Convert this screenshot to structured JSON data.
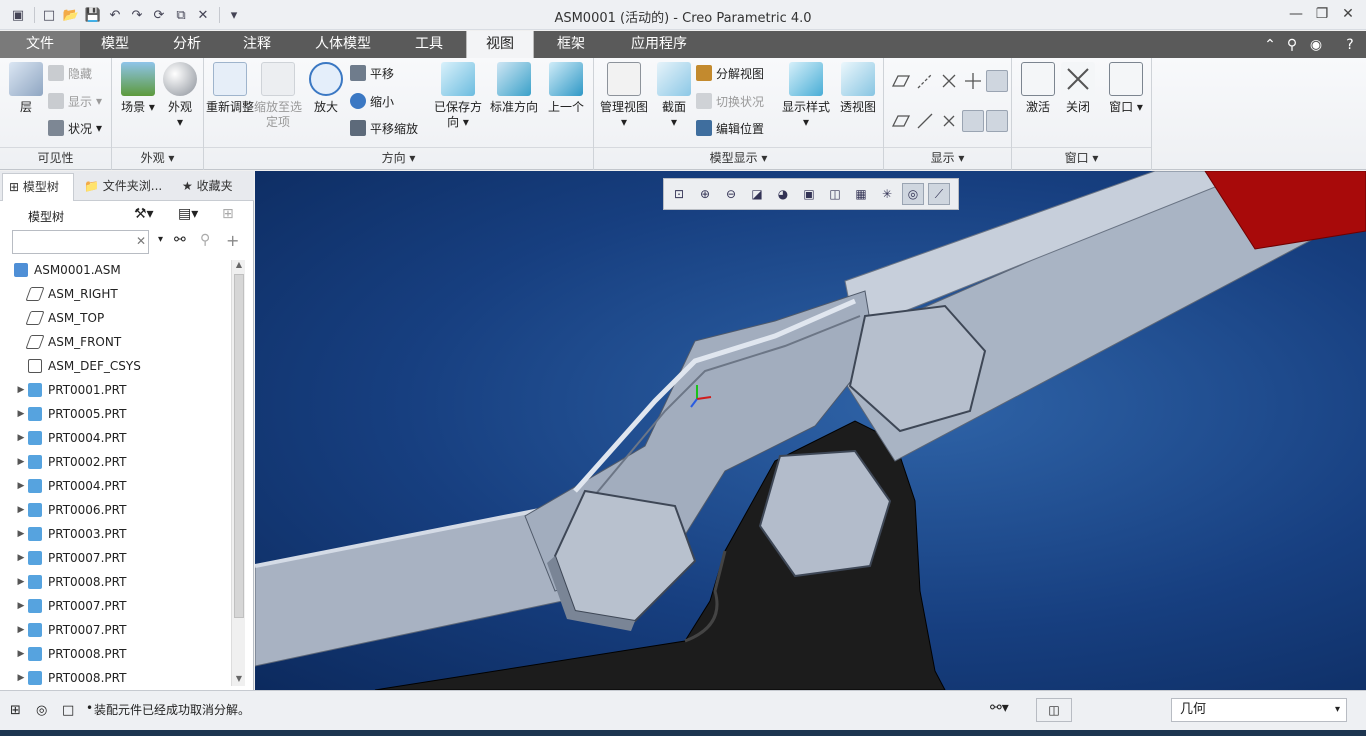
{
  "window": {
    "title": "ASM0001 (活动的) - Creo Parametric 4.0"
  },
  "quick_access": [
    "new-icon",
    "open-icon",
    "save-icon",
    "undo-icon",
    "redo-icon",
    "regenerate-icon",
    "windows-icon",
    "close-window-icon",
    "customize-icon"
  ],
  "tabs": [
    {
      "label": "文件"
    },
    {
      "label": "模型"
    },
    {
      "label": "分析"
    },
    {
      "label": "注释"
    },
    {
      "label": "人体模型"
    },
    {
      "label": "工具"
    },
    {
      "label": "视图"
    },
    {
      "label": "框架"
    },
    {
      "label": "应用程序"
    }
  ],
  "ribbon": {
    "visibility": {
      "label": "可见性",
      "layer": "层",
      "hide": "隐藏",
      "show": "显示",
      "status": "状况"
    },
    "appearance": {
      "label": "外观",
      "scene": "场景",
      "appearance": "外观"
    },
    "orientation": {
      "label": "方向",
      "refit": "重新调整",
      "zoom_selected": "缩放至选定项",
      "zoom_in": "放大",
      "pan": "平移",
      "zoom_out": "缩小",
      "pan_zoom": "平移缩放",
      "saved_orientations": "已保存方向",
      "standard_orientation": "标准方向",
      "previous": "上一个"
    },
    "model_display": {
      "label": "模型显示",
      "manage_views": "管理视图",
      "section": "截面",
      "explode_view": "分解视图",
      "toggle_status": "切换状况",
      "edit_position": "编辑位置",
      "display_style": "显示样式",
      "perspective": "透视图"
    },
    "show": {
      "label": "显示"
    },
    "window": {
      "label": "窗口",
      "activate": "激活",
      "close": "关闭",
      "window": "窗口"
    }
  },
  "panel": {
    "tabs": [
      "模型树",
      "文件夹浏...",
      "收藏夹"
    ],
    "tree_header": "模型树",
    "search_placeholder": "",
    "tree": [
      {
        "name": "ASM0001.ASM",
        "kind": "asm",
        "expandable": false
      },
      {
        "name": "ASM_RIGHT",
        "kind": "plane",
        "expandable": false
      },
      {
        "name": "ASM_TOP",
        "kind": "plane",
        "expandable": false
      },
      {
        "name": "ASM_FRONT",
        "kind": "plane",
        "expandable": false
      },
      {
        "name": "ASM_DEF_CSYS",
        "kind": "csys",
        "expandable": false
      },
      {
        "name": "PRT0001.PRT",
        "kind": "part",
        "expandable": true
      },
      {
        "name": "PRT0005.PRT",
        "kind": "part",
        "expandable": true
      },
      {
        "name": "PRT0004.PRT",
        "kind": "part",
        "expandable": true
      },
      {
        "name": "PRT0002.PRT",
        "kind": "part",
        "expandable": true
      },
      {
        "name": "PRT0004.PRT",
        "kind": "part",
        "expandable": true
      },
      {
        "name": "PRT0006.PRT",
        "kind": "part",
        "expandable": true
      },
      {
        "name": "PRT0003.PRT",
        "kind": "part",
        "expandable": true
      },
      {
        "name": "PRT0007.PRT",
        "kind": "part",
        "expandable": true
      },
      {
        "name": "PRT0008.PRT",
        "kind": "part",
        "expandable": true
      },
      {
        "name": "PRT0007.PRT",
        "kind": "part",
        "expandable": true
      },
      {
        "name": "PRT0007.PRT",
        "kind": "part",
        "expandable": true
      },
      {
        "name": "PRT0008.PRT",
        "kind": "part",
        "expandable": true
      },
      {
        "name": "PRT0008.PRT",
        "kind": "part",
        "expandable": true
      }
    ]
  },
  "status": {
    "message": "装配元件已经成功取消分解。",
    "filter": "几何"
  },
  "colors": {
    "tab_bar": "#5a5a5a",
    "viewport_bg": "#173f80",
    "part_gray": "#a9b4c4",
    "part_red": "#a80a0a",
    "base_black": "#1c1c1c"
  }
}
